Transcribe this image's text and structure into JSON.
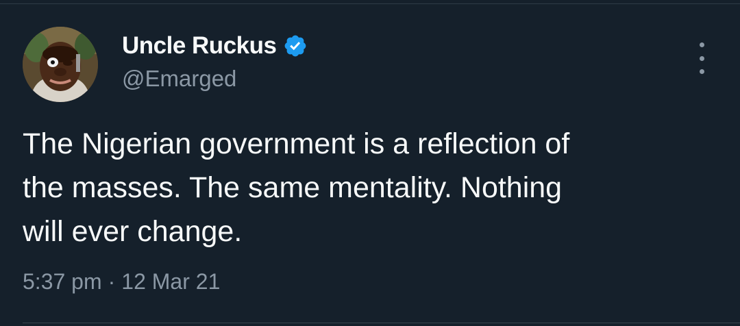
{
  "tweet": {
    "display_name": "Uncle Ruckus",
    "handle": "@Emarged",
    "verified": true,
    "text": "The Nigerian government is a reflection of\nthe masses. The same mentality. Nothing\nwill ever change.",
    "time": "5:37 pm",
    "separator": "·",
    "date": "12 Mar 21"
  },
  "icons": {
    "verified": "verified-badge-icon",
    "more": "more-options-icon"
  },
  "colors": {
    "background": "#15202b",
    "text_primary": "#f7f9f9",
    "text_secondary": "#8b98a5",
    "verified_blue": "#1d9bf0"
  }
}
